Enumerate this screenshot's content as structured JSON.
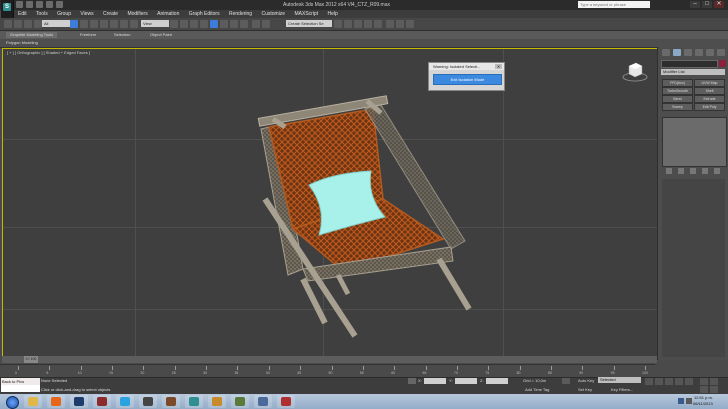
{
  "window": {
    "title": "Autodesk 3ds Max 2012 x64    Vl4_CTZ_R09.max",
    "search_placeholder": "Type a keyword or phrase",
    "minimize": "–",
    "maximize": "□",
    "close": "✕"
  },
  "menu": [
    "Edit",
    "Tools",
    "Group",
    "Views",
    "Create",
    "Modifiers",
    "Animation",
    "Graph Editors",
    "Rendering",
    "Customize",
    "MAXScript",
    "Help"
  ],
  "toolbar": {
    "selection_filter": "All",
    "ref_coord": "View",
    "named_selection": "Create Selection Se"
  },
  "ribbon": {
    "tabs": [
      "Graphite Modeling Tools",
      "Freeform",
      "Selection",
      "Object Paint"
    ],
    "sub_label": "Polygon Modeling"
  },
  "viewport": {
    "label": "[ + ] [ Orthographic ] [ Shaded + Edged Faces ]"
  },
  "isolate_dialog": {
    "title": "Warning: Isolated Selecti...",
    "close": "✕",
    "button": "Exit Isolation Mode"
  },
  "command_panel": {
    "modifier_list": "Modifier List",
    "modifier_buttons": [
      "FFD(box)",
      "UVW Map",
      "TurboSmooth",
      "Shell",
      "Bend",
      "Extrude",
      "Sweep",
      "Edit Poly"
    ]
  },
  "timeline": {
    "frame_indicator": "0 / 100",
    "ticks": [
      "0",
      "5",
      "10",
      "15",
      "20",
      "25",
      "30",
      "35",
      "40",
      "45",
      "50",
      "55",
      "60",
      "65",
      "70",
      "75",
      "80",
      "85",
      "90",
      "95",
      "100"
    ]
  },
  "status": {
    "maxscript_line1": "Back to Pivo",
    "maxscript_line2": "",
    "selection": "None Selected",
    "prompt": "Click or click-and-drag to select objects",
    "x_label": "X:",
    "y_label": "Y:",
    "z_label": "Z:",
    "grid": "Grid = 10,0m",
    "add_time_tag": "Add Time Tag",
    "auto_key": "Auto Key",
    "set_key": "Set Key",
    "selection_dropdown": "Selected",
    "key_filters": "Key Filters..."
  },
  "taskbar": {
    "time": "12:51 p.m.",
    "date": "06/11/2013",
    "apps": [
      {
        "name": "windows-explorer-icon",
        "color": "#e0b84a"
      },
      {
        "name": "firefox-icon",
        "color": "#e8661a"
      },
      {
        "name": "photoshop-icon",
        "color": "#1e3c6b"
      },
      {
        "name": "zip-icon",
        "color": "#8c2b2b"
      },
      {
        "name": "skype-icon",
        "color": "#2aa4e0"
      },
      {
        "name": "media-icon",
        "color": "#444444"
      },
      {
        "name": "video-icon",
        "color": "#7a4a2a"
      },
      {
        "name": "3dsmax-icon",
        "color": "#2f8f93"
      },
      {
        "name": "paint-icon",
        "color": "#c98a2a"
      },
      {
        "name": "game-icon",
        "color": "#5a7a3a"
      },
      {
        "name": "network-icon",
        "color": "#4a6a9a"
      },
      {
        "name": "tools-icon",
        "color": "#b03030"
      }
    ]
  },
  "colors": {
    "viewport_border": "#c7b800",
    "accent_blue": "#3b8ae0",
    "object_color": "#8a1f3e",
    "chair_frame": "#a8a090",
    "chair_weave": "#c2581b",
    "pillow": "#a8f0ea"
  }
}
